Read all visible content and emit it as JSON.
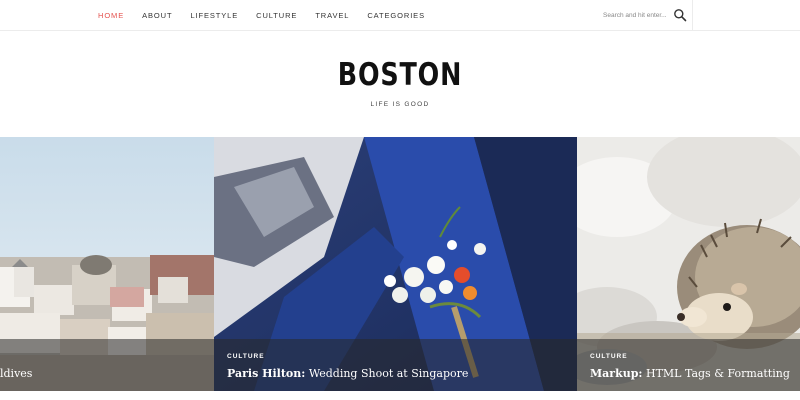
{
  "nav": {
    "items": [
      {
        "label": "HOME",
        "active": true
      },
      {
        "label": "ABOUT",
        "active": false
      },
      {
        "label": "LIFESTYLE",
        "active": false
      },
      {
        "label": "CULTURE",
        "active": false
      },
      {
        "label": "TRAVEL",
        "active": false
      },
      {
        "label": "CATEGORIES",
        "active": false
      }
    ],
    "active_color": "#e4534f"
  },
  "search": {
    "placeholder": "Search and hit enter...",
    "icon": "search-icon"
  },
  "brand": {
    "title": "BOSTON",
    "tagline": "LIFE IS GOOD"
  },
  "slides": [
    {
      "category": "",
      "title_bold": "",
      "title_rest": "ldives",
      "image": "santorini-village-photo"
    },
    {
      "category": "CULTURE",
      "title_bold": "Paris Hilton:",
      "title_rest": " Wedding Shoot at Singapore",
      "image": "wedding-boutonniere-photo"
    },
    {
      "category": "CULTURE",
      "title_bold": "Markup:",
      "title_rest": " HTML Tags & Formatting",
      "image": "hedgehog-photo"
    }
  ]
}
